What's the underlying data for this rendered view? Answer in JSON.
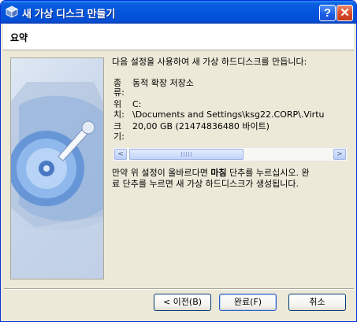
{
  "window": {
    "title": "새 가상 디스크 만들기",
    "title_icon": "virtualbox-cube-icon",
    "help_label": "?",
    "close_label": "✕"
  },
  "header": {
    "title": "요약"
  },
  "intro": "다음 설정을 사용하여 새 가상 하드디스크를 만듭니다:",
  "summary": {
    "type_label_1": "종",
    "type_label_2": "류:",
    "type_value": "동적 확장 저장소",
    "location_label_1": "위",
    "location_label_2": "치:",
    "location_value_line1": "C:",
    "location_value_line2": "\\Documents and Settings\\ksg22.CORP\\.Virtu",
    "size_label_1": "크",
    "size_label_2": "기:",
    "size_value": "20,00 GB (21474836480 바이트)"
  },
  "scrollbar": {
    "left_arrow": "<",
    "right_arrow": ">",
    "thumb_position_fraction": 0.0
  },
  "instructions": {
    "line1_pre": "만약 위 설정이 올바르다면 ",
    "line1_bold": "마침",
    "line1_post": " 단추를 누르십시오. 완",
    "line2": "료 단추를 누르면 새 가상 하드디스크가 생성됩니다."
  },
  "buttons": {
    "back": "< 이전(B)",
    "finish": "완료(F)",
    "cancel": "취소"
  },
  "colors": {
    "titlebar": "#0554dc",
    "window_bg": "#ece9d8",
    "close_button": "#d8492a"
  }
}
